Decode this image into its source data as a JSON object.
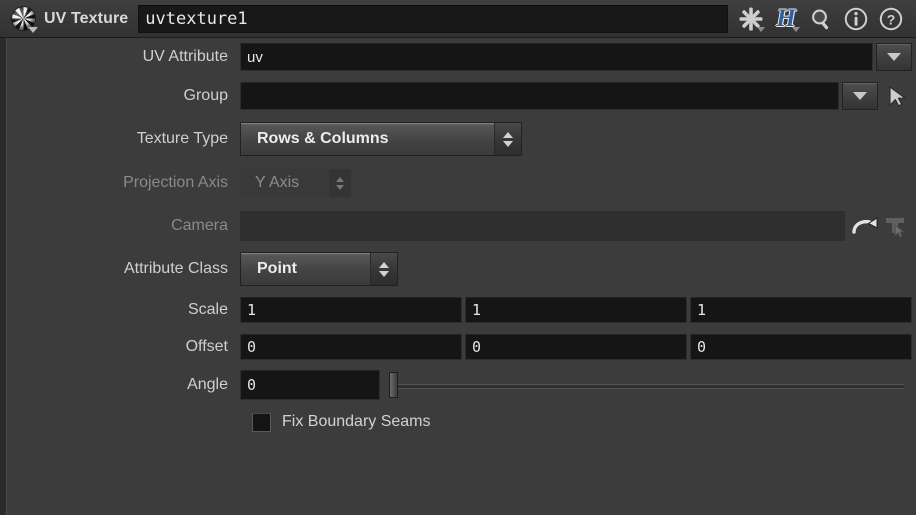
{
  "window": {
    "node_icon": "checkered-sphere-icon",
    "title": "UV Texture",
    "name_value": "uvtexture1",
    "toolbar": [
      {
        "icon": "gear-icon",
        "has_caret": true
      },
      {
        "icon": "houdini-h-icon",
        "label": "H",
        "has_caret": true
      },
      {
        "icon": "search-icon",
        "has_caret": false
      },
      {
        "icon": "info-icon",
        "has_caret": false
      },
      {
        "icon": "help-icon",
        "has_caret": false
      }
    ]
  },
  "parameters": {
    "uv_attribute": {
      "label": "UV Attribute",
      "value": "uv",
      "dropdown_icon": "chevron-down-icon"
    },
    "group": {
      "label": "Group",
      "value": "",
      "dropdown_icon": "chevron-down-icon",
      "picker_icon": "arrow-pointer-icon"
    },
    "texture_type": {
      "label": "Texture Type",
      "value": "Rows & Columns"
    },
    "projection_axis": {
      "label": "Projection Axis",
      "value": "Y Axis",
      "disabled": true
    },
    "camera": {
      "label": "Camera",
      "value": "",
      "disabled": true,
      "reload_icon": "curved-arrow-icon",
      "pick_icon": "camera-pick-icon"
    },
    "attribute_class": {
      "label": "Attribute Class",
      "value": "Point"
    },
    "scale": {
      "label": "Scale",
      "values": [
        "1",
        "1",
        "1"
      ]
    },
    "offset": {
      "label": "Offset",
      "values": [
        "0",
        "0",
        "0"
      ]
    },
    "angle": {
      "label": "Angle",
      "value": "0",
      "slider_position_percent": 0
    },
    "fix_boundary_seams": {
      "label": "Fix Boundary Seams",
      "checked": false
    }
  },
  "colors": {
    "panel_bg": "#3c3c3c",
    "field_bg": "#151515",
    "label_text": "#cfcfcf",
    "label_disabled": "#8a8a8a",
    "accent_h_blue": "#2f5f9e"
  }
}
